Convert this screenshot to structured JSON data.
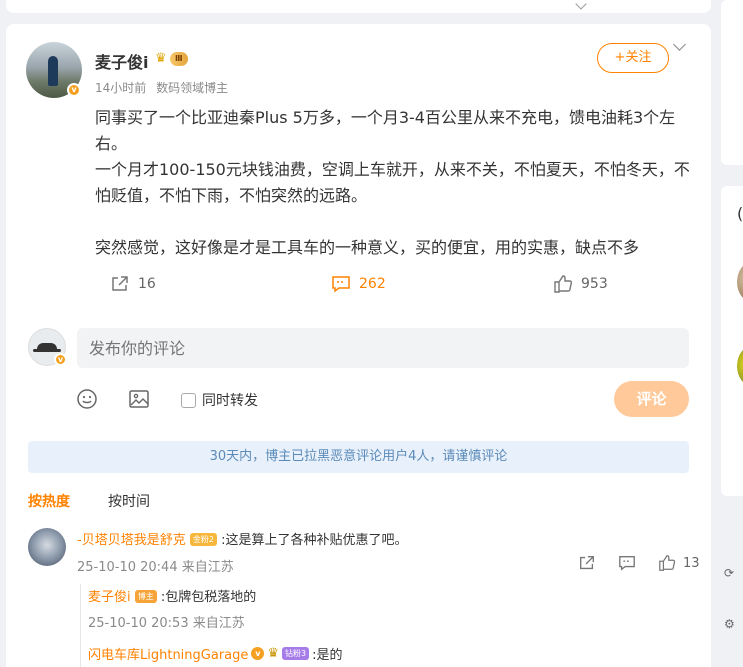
{
  "post": {
    "author": "麦子俊i",
    "author_level": "Ⅲ",
    "time": "14小时前",
    "author_tag": "数码领域博主",
    "follow_label": "+关注",
    "paragraphs": [
      "同事买了一个比亚迪秦Plus 5万多，一个月3-4百公里从来不充电，馈电油耗3个左右。",
      "一个月才100-150元块钱油费，空调上车就开，从来不关，不怕夏天，不怕冬天，不怕贬值，不怕下雨，不怕突然的远路。",
      "",
      "突然感觉，这好像是才是工具车的一种意义，买的便宜，用的实惠，缺点不多"
    ],
    "repost_count": "16",
    "comment_count": "262",
    "like_count": "953"
  },
  "composer": {
    "placeholder": "发布你的评论",
    "forward_label": "同时转发",
    "submit_label": "评论"
  },
  "notice": "30天内，博主已拉黑恶意评论用户4人，请谨慎评论",
  "sort": {
    "hot": "按热度",
    "time": "按时间"
  },
  "comments": [
    {
      "user": "-贝塔贝塔我是舒克",
      "badge": "金粉2",
      "text": ":这是算上了各种补贴优惠了吧。",
      "time": "25-10-10 20:44 来自江苏",
      "like_count": "13",
      "replies": [
        {
          "user": "麦子俊i",
          "badge": "博主",
          "text": ":包牌包税落地的",
          "time": "25-10-10 20:53 来自江苏"
        },
        {
          "user": "闪电车库LightningGarage",
          "badge": "钻粉3",
          "text": ":是的"
        }
      ]
    }
  ],
  "colors": {
    "accent": "#ff8200",
    "notice_bg": "#e8f1fb",
    "notice_text": "#5b8ab8",
    "page_bg": "#f0f1f4"
  }
}
